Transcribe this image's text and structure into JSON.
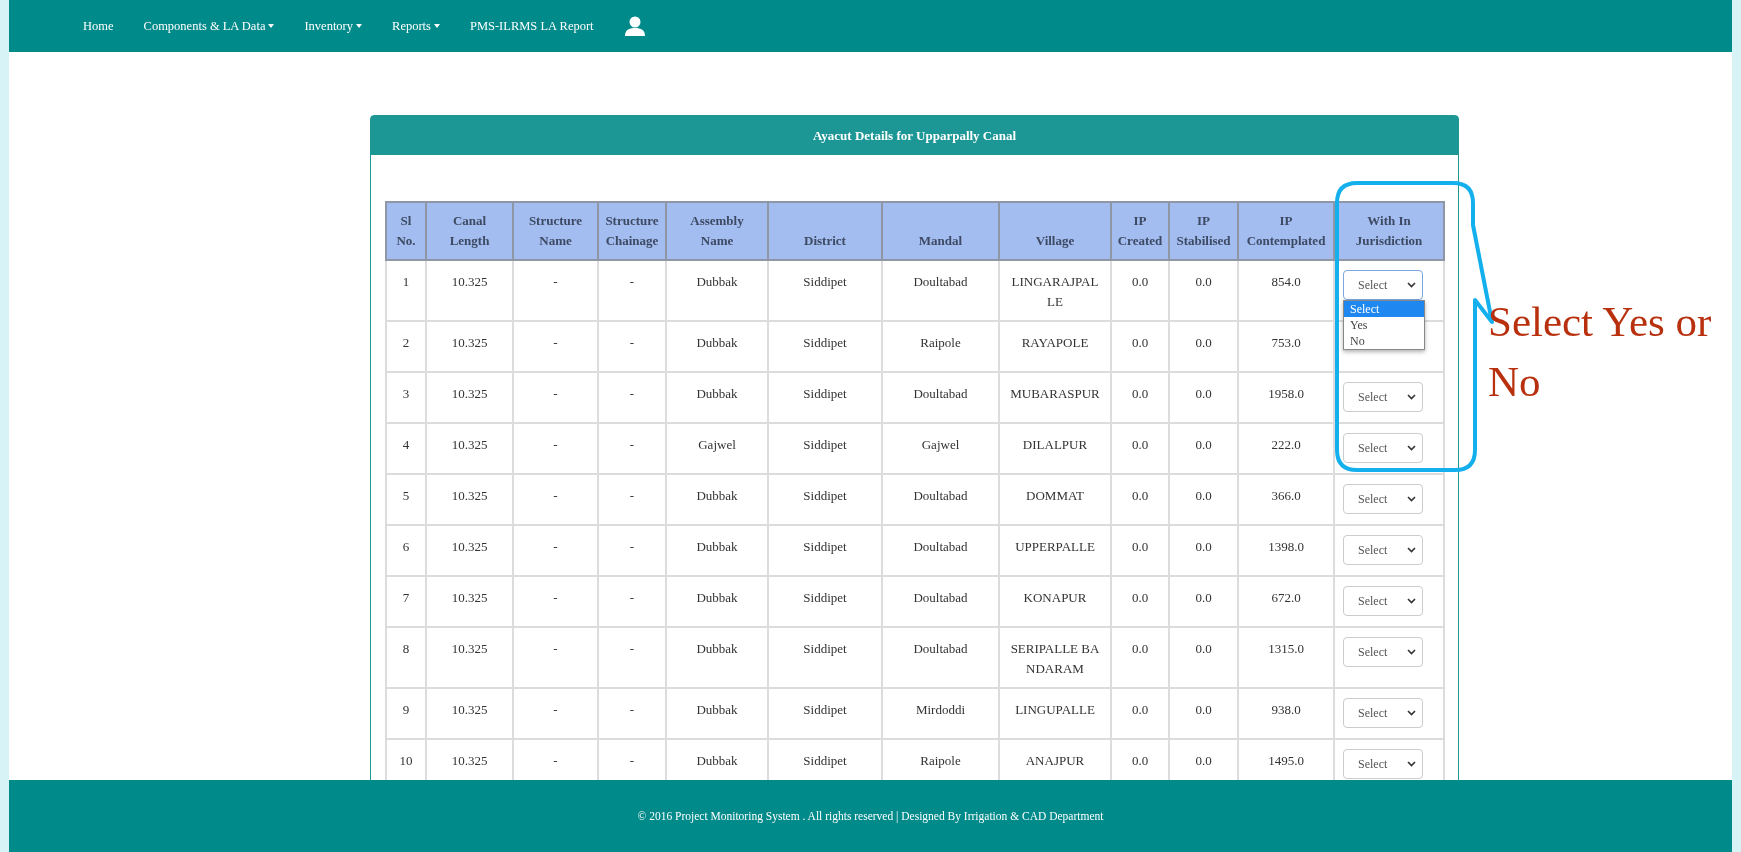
{
  "nav": {
    "items": [
      {
        "label": "Home",
        "dropdown": false
      },
      {
        "label": "Components & LA Data",
        "dropdown": true
      },
      {
        "label": "Inventory",
        "dropdown": true
      },
      {
        "label": "Reports",
        "dropdown": true
      },
      {
        "label": "PMS-ILRMS LA Report",
        "dropdown": false
      }
    ]
  },
  "panel": {
    "title": "Ayacut Details for Upparpally Canal"
  },
  "table": {
    "columns": [
      "Sl\nNo.",
      "Canal\nLength",
      "Structure\nName",
      "Structure\nChainage",
      "Assembly\nName",
      "District",
      "Mandal",
      "Village",
      "IP\nCreated",
      "IP\nStabilised",
      "IP\nContemplated",
      "With In\nJurisdiction"
    ],
    "dropdown_options": [
      {
        "label": "Select",
        "selected": true
      },
      {
        "label": "Yes",
        "selected": false
      },
      {
        "label": "No",
        "selected": false
      }
    ],
    "rows": [
      {
        "cells": [
          "1",
          "10.325",
          "-",
          "-",
          "Dubbak",
          "Siddipet",
          "Doultabad",
          "LINGARAJPALLE",
          "0.0",
          "0.0",
          "854.0"
        ],
        "jurisdiction": "Select",
        "open": true
      },
      {
        "cells": [
          "2",
          "10.325",
          "-",
          "-",
          "Dubbak",
          "Siddipet",
          "Raipole",
          "RAYAPOLE",
          "0.0",
          "0.0",
          "753.0"
        ]
      },
      {
        "cells": [
          "3",
          "10.325",
          "-",
          "-",
          "Dubbak",
          "Siddipet",
          "Doultabad",
          "MUBARASPUR",
          "0.0",
          "0.0",
          "1958.0"
        ],
        "jurisdiction": "Select",
        "open": false
      },
      {
        "cells": [
          "4",
          "10.325",
          "-",
          "-",
          "Gajwel",
          "Siddipet",
          "Gajwel",
          "DILALPUR",
          "0.0",
          "0.0",
          "222.0"
        ],
        "jurisdiction": "Select",
        "open": false
      },
      {
        "cells": [
          "5",
          "10.325",
          "-",
          "-",
          "Dubbak",
          "Siddipet",
          "Doultabad",
          "DOMMAT",
          "0.0",
          "0.0",
          "366.0"
        ],
        "jurisdiction": "Select",
        "open": false
      },
      {
        "cells": [
          "6",
          "10.325",
          "-",
          "-",
          "Dubbak",
          "Siddipet",
          "Doultabad",
          "UPPERPALLE",
          "0.0",
          "0.0",
          "1398.0"
        ],
        "jurisdiction": "Select",
        "open": false
      },
      {
        "cells": [
          "7",
          "10.325",
          "-",
          "-",
          "Dubbak",
          "Siddipet",
          "Doultabad",
          "KONAPUR",
          "0.0",
          "0.0",
          "672.0"
        ],
        "jurisdiction": "Select",
        "open": false
      },
      {
        "cells": [
          "8",
          "10.325",
          "-",
          "-",
          "Dubbak",
          "Siddipet",
          "Doultabad",
          "SERIPALLE BANDARAM",
          "0.0",
          "0.0",
          "1315.0"
        ],
        "jurisdiction": "Select",
        "open": false
      },
      {
        "cells": [
          "9",
          "10.325",
          "-",
          "-",
          "Dubbak",
          "Siddipet",
          "Mirdoddi",
          "LINGUPALLE",
          "0.0",
          "0.0",
          "938.0"
        ],
        "jurisdiction": "Select",
        "open": false
      },
      {
        "cells": [
          "10",
          "10.325",
          "-",
          "-",
          "Dubbak",
          "Siddipet",
          "Raipole",
          "ANAJPUR",
          "0.0",
          "0.0",
          "1495.0"
        ],
        "jurisdiction": "Select",
        "open": false
      }
    ]
  },
  "annotation": {
    "text": "Select Yes or No"
  },
  "footer": {
    "text": "© 2016 Project Monitoring System . All rights reserved | Designed By Irrigation & CAD Department"
  }
}
